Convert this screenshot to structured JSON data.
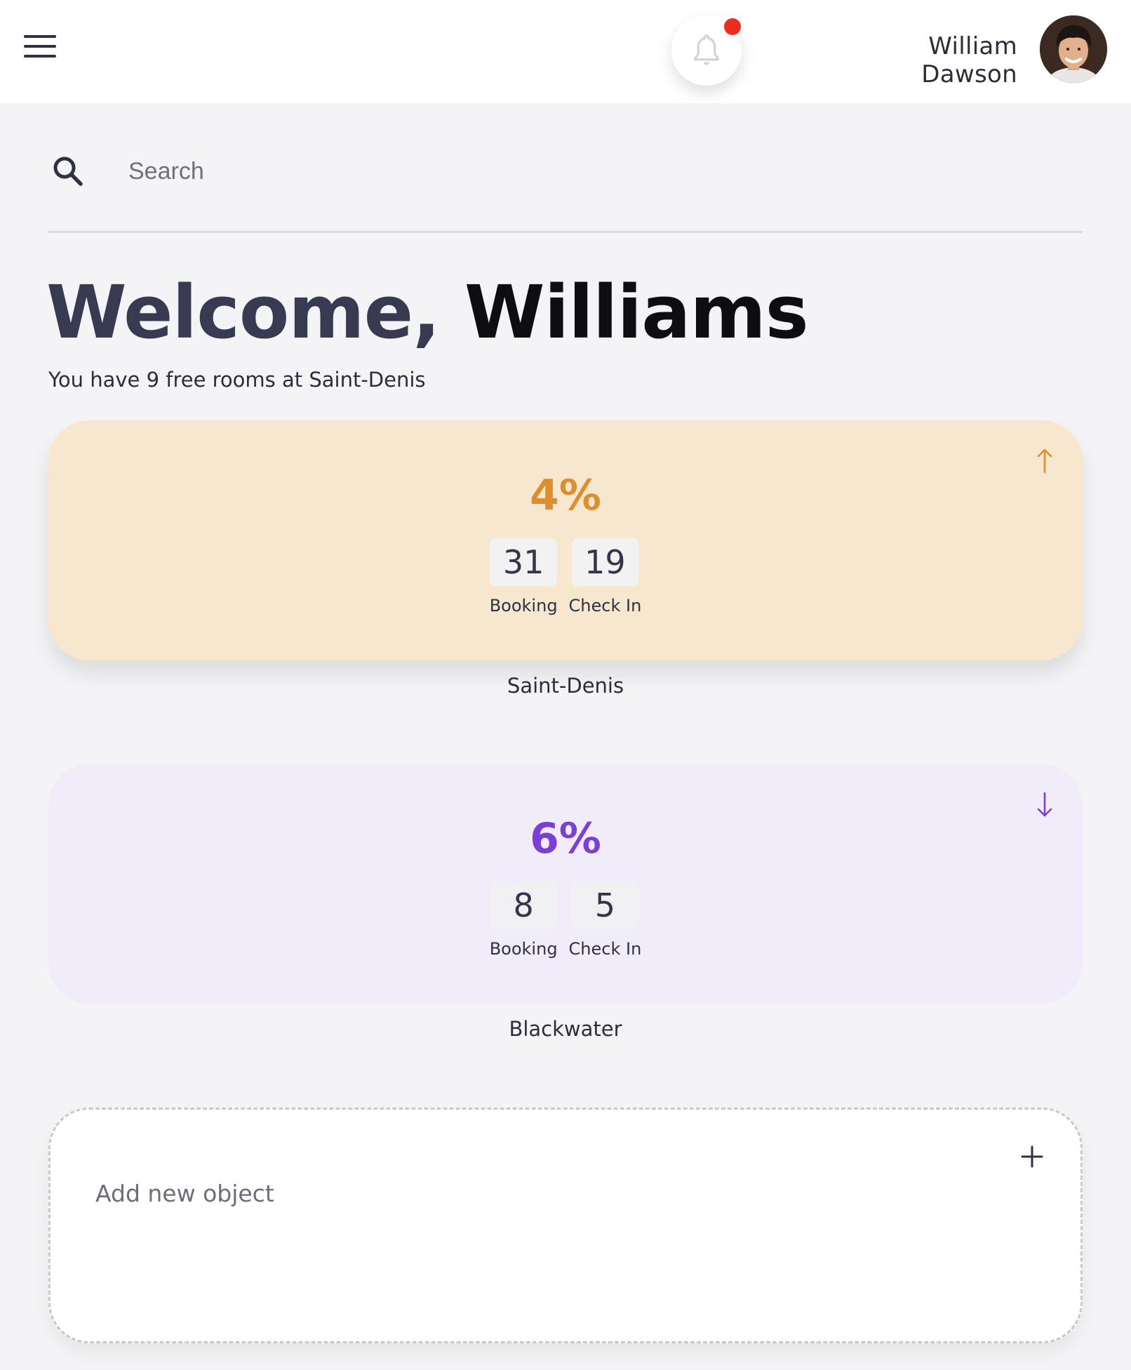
{
  "header": {
    "user_name": "William Dawson",
    "notification_dot": true
  },
  "search": {
    "placeholder": "Search",
    "value": ""
  },
  "welcome": {
    "greeting": "Welcome,",
    "name": "Williams",
    "subtitle": "You have 9 free rooms at Saint-Denis"
  },
  "cards": [
    {
      "percent": "4%",
      "trend": "up",
      "accent": "#dd8f2f",
      "background": "#f8e7cf",
      "booking": "31",
      "booking_label": "Booking",
      "checkin": "19",
      "checkin_label": "Check In",
      "location": "Saint-Denis"
    },
    {
      "percent": "6%",
      "trend": "down",
      "accent": "#7a3fd4",
      "background": "#f2ecfa",
      "booking": "8",
      "booking_label": "Booking",
      "checkin": "5",
      "checkin_label": "Check In",
      "location": "Blackwater"
    }
  ],
  "add_object": {
    "label": "Add new object"
  },
  "icons": {
    "menu": "hamburger-menu-icon",
    "bell": "bell-icon",
    "search": "search-icon",
    "trend_up": "arrow-up-icon",
    "trend_down": "arrow-down-icon",
    "add": "plus-icon"
  }
}
